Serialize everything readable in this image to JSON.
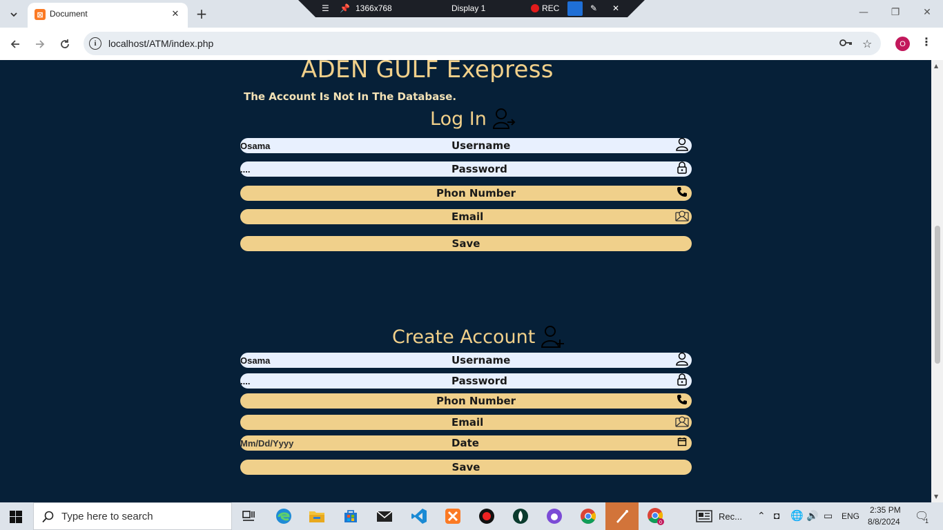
{
  "browser": {
    "tab_title": "Document",
    "url": "localhost/ATM/index.php",
    "profile_initial": "O"
  },
  "recorder": {
    "resolution": "1366x768",
    "display": "Display 1",
    "rec_label": "REC"
  },
  "page": {
    "site_title": "ADEN GULF Exepress",
    "error_message": "The Account Is Not In The Database.",
    "login": {
      "title": "Log In",
      "username_value": "Osama",
      "username_label": "Username",
      "password_value": "....",
      "password_label": "Password",
      "phone_label": "Phon Number",
      "email_label": "Email",
      "save_label": "Save"
    },
    "create": {
      "title": "Create Account",
      "username_value": "Osama",
      "username_label": "Username",
      "password_value": "....",
      "password_label": "Password",
      "phone_label": "Phon Number",
      "email_label": "Email",
      "date_placeholder": "Mm/Dd/Yyyy",
      "date_label": "Date",
      "save_label": "Save"
    }
  },
  "taskbar": {
    "search_placeholder": "Type here to search",
    "rec_app_label": "Rec...",
    "language": "ENG",
    "time": "2:35 PM",
    "date": "8/8/2024",
    "notification_count": "1",
    "chrome_badge": "0"
  }
}
